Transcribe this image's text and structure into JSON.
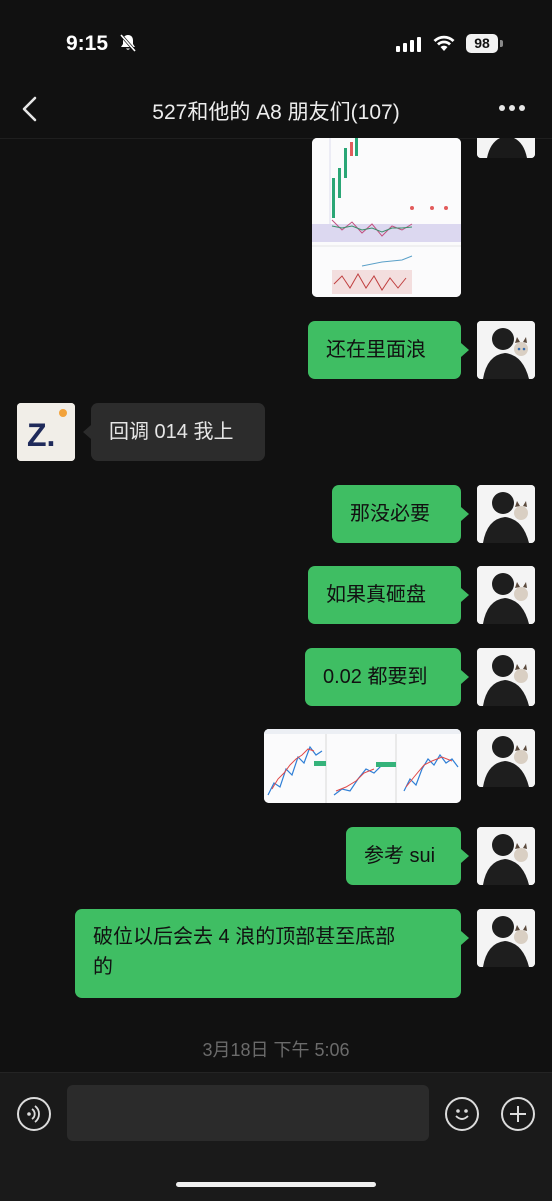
{
  "status_bar": {
    "time": "9:15",
    "battery": "98"
  },
  "header": {
    "title": "527和他的 A8 朋友们(107)"
  },
  "messages": [
    {
      "type": "image",
      "from": "me",
      "alt": "chart screenshot"
    },
    {
      "type": "text",
      "from": "me",
      "text": "还在里面浪"
    },
    {
      "type": "text",
      "from": "other",
      "text": "回调 014 我上"
    },
    {
      "type": "text",
      "from": "me",
      "text": "那没必要"
    },
    {
      "type": "text",
      "from": "me",
      "text": "如果真砸盘"
    },
    {
      "type": "text",
      "from": "me",
      "text": "0.02 都要到"
    },
    {
      "type": "image",
      "from": "me",
      "alt": "three chart screenshots"
    },
    {
      "type": "text",
      "from": "me",
      "text": "参考 sui"
    },
    {
      "type": "text",
      "from": "me",
      "text_line1": "破位以后会去 4 浪的顶部甚至底部",
      "text_line2": "的"
    }
  ],
  "timestamp": "3月18日 下午 5:06",
  "other_avatar_letter": "Z.",
  "colors": {
    "bubble_me": "#3fbe63",
    "bubble_other": "#2c2c2c",
    "background": "#111111"
  }
}
